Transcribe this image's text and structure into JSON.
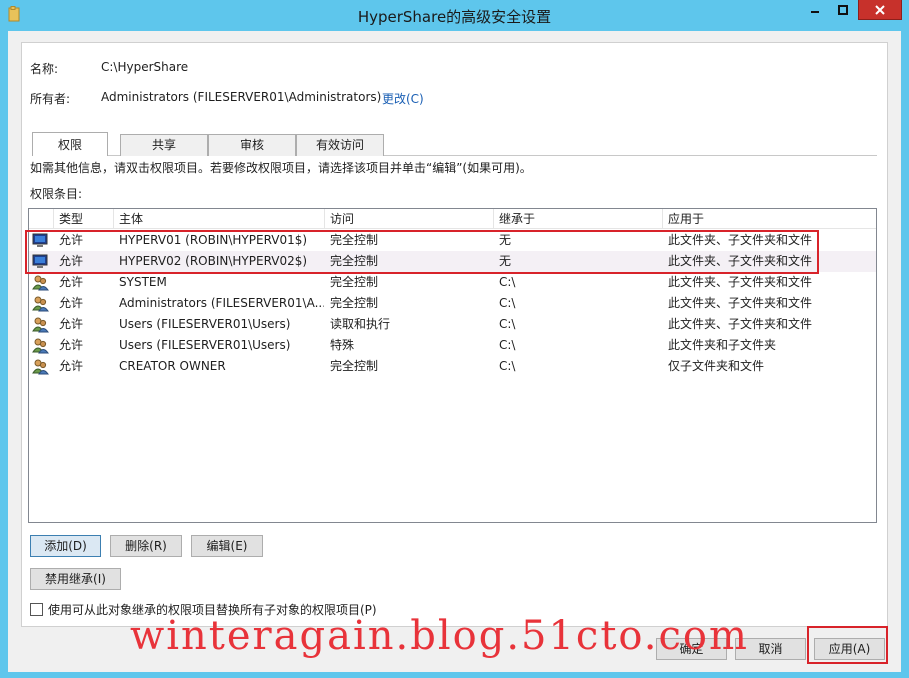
{
  "window": {
    "title": "HyperShare的高级安全设置"
  },
  "info": {
    "name_label": "名称:",
    "name_value": "C:\\HyperShare",
    "owner_label": "所有者:",
    "owner_value": "Administrators (FILESERVER01\\Administrators)",
    "change_link": "更改(C)"
  },
  "tabs": [
    {
      "label": "权限",
      "active": true
    },
    {
      "label": "共享",
      "active": false
    },
    {
      "label": "审核",
      "active": false
    },
    {
      "label": "有效访问",
      "active": false
    }
  ],
  "permissions": {
    "hint": "如需其他信息，请双击权限项目。若要修改权限项目，请选择该项目并单击“编辑”(如果可用)。",
    "entries_label": "权限条目:",
    "columns": [
      "类型",
      "主体",
      "访问",
      "继承于",
      "应用于"
    ],
    "rows": [
      {
        "icon": "computer-icon",
        "type": "允许",
        "principal": "HYPERV01 (ROBIN\\HYPERV01$)",
        "access": "完全控制",
        "inherited": "无",
        "applies": "此文件夹、子文件夹和文件"
      },
      {
        "icon": "computer-icon",
        "type": "允许",
        "principal": "HYPERV02 (ROBIN\\HYPERV02$)",
        "access": "完全控制",
        "inherited": "无",
        "applies": "此文件夹、子文件夹和文件"
      },
      {
        "icon": "users-icon",
        "type": "允许",
        "principal": "SYSTEM",
        "access": "完全控制",
        "inherited": "C:\\",
        "applies": "此文件夹、子文件夹和文件"
      },
      {
        "icon": "users-icon",
        "type": "允许",
        "principal": "Administrators (FILESERVER01\\A...",
        "access": "完全控制",
        "inherited": "C:\\",
        "applies": "此文件夹、子文件夹和文件"
      },
      {
        "icon": "users-icon",
        "type": "允许",
        "principal": "Users (FILESERVER01\\Users)",
        "access": "读取和执行",
        "inherited": "C:\\",
        "applies": "此文件夹、子文件夹和文件"
      },
      {
        "icon": "users-icon",
        "type": "允许",
        "principal": "Users (FILESERVER01\\Users)",
        "access": "特殊",
        "inherited": "C:\\",
        "applies": "此文件夹和子文件夹"
      },
      {
        "icon": "users-icon",
        "type": "允许",
        "principal": "CREATOR OWNER",
        "access": "完全控制",
        "inherited": "C:\\",
        "applies": "仅子文件夹和文件"
      }
    ]
  },
  "buttons": {
    "add": "添加(D)",
    "remove": "删除(R)",
    "edit": "编辑(E)",
    "disable_inheritance": "禁用继承(I)",
    "ok": "确定",
    "cancel": "取消",
    "apply": "应用(A)"
  },
  "replace_checkbox": {
    "label": "使用可从此对象继承的权限项目替换所有子对象的权限项目(P)",
    "checked": false
  },
  "watermark": "winteragain.blog.51cto.com",
  "colors": {
    "titlebar": "#5ec6ec",
    "close_button": "#c7312b",
    "highlight_box": "#d8232a",
    "link": "#1a5fb4"
  }
}
